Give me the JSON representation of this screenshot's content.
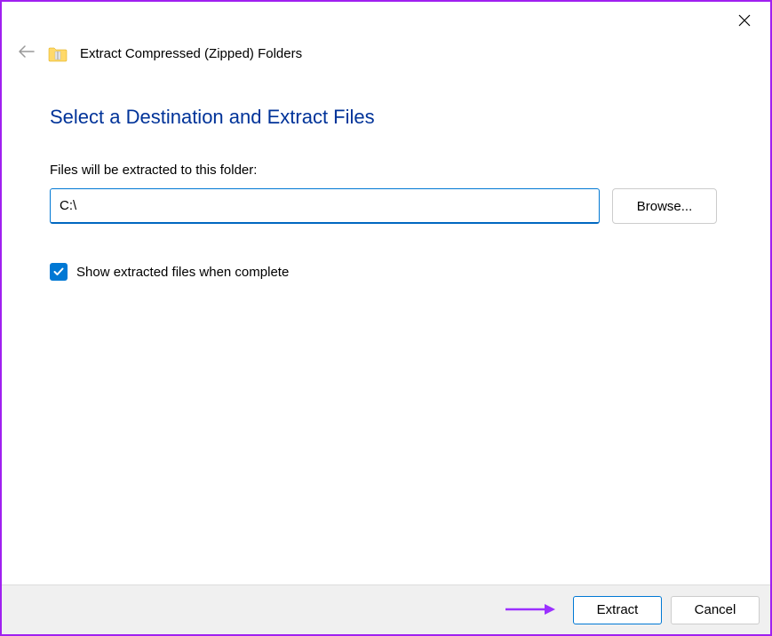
{
  "window": {
    "title": "Extract Compressed (Zipped) Folders"
  },
  "main": {
    "heading": "Select a Destination and Extract Files",
    "field_label": "Files will be extracted to this folder:",
    "path_value": "C:\\",
    "browse_label": "Browse...",
    "checkbox_label": "Show extracted files when complete",
    "checkbox_checked": true
  },
  "footer": {
    "extract_label": "Extract",
    "cancel_label": "Cancel"
  }
}
